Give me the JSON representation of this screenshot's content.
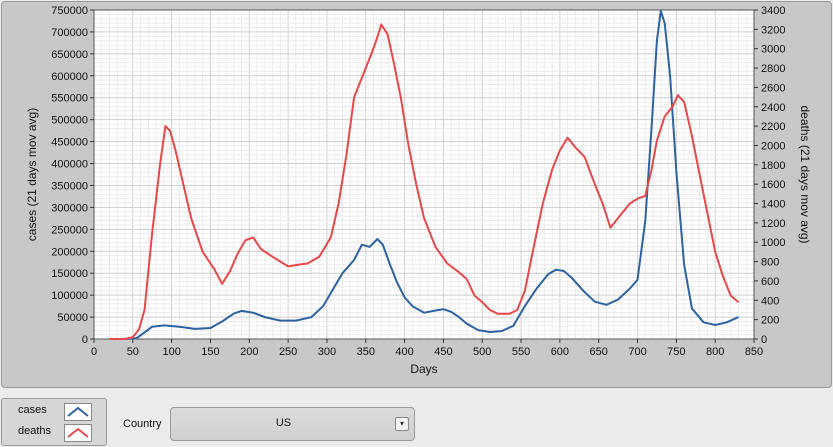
{
  "chart_data": {
    "type": "line",
    "xlabel": "Days",
    "ylabel_left": "cases  (21 days mov avg)",
    "ylabel_right": "deaths  (21 days mov avg)",
    "xlim": [
      0,
      850
    ],
    "ylim_left": [
      0,
      750000
    ],
    "ylim_right": [
      0,
      3400
    ],
    "x_ticks": [
      "0",
      "50",
      "100",
      "150",
      "200",
      "250",
      "300",
      "350",
      "400",
      "450",
      "500",
      "550",
      "600",
      "650",
      "700",
      "750",
      "800",
      "850"
    ],
    "y_left_ticks": [
      "0",
      "50000",
      "100000",
      "150000",
      "200000",
      "250000",
      "300000",
      "350000",
      "400000",
      "450000",
      "500000",
      "550000",
      "600000",
      "650000",
      "700000",
      "750000"
    ],
    "y_right_ticks": [
      "0",
      "200",
      "400",
      "600",
      "800",
      "1000",
      "1200",
      "1400",
      "1600",
      "1800",
      "2000",
      "2200",
      "2400",
      "2600",
      "2800",
      "3000",
      "3200",
      "3400"
    ],
    "grid": true,
    "series": [
      {
        "name": "cases",
        "axis": "left",
        "color": "#2e62a0",
        "points": [
          [
            20,
            0
          ],
          [
            40,
            0
          ],
          [
            55,
            2000
          ],
          [
            65,
            15000
          ],
          [
            75,
            28000
          ],
          [
            90,
            31000
          ],
          [
            110,
            28000
          ],
          [
            130,
            23000
          ],
          [
            150,
            25000
          ],
          [
            165,
            40000
          ],
          [
            180,
            58000
          ],
          [
            190,
            64000
          ],
          [
            205,
            60000
          ],
          [
            220,
            50000
          ],
          [
            240,
            42000
          ],
          [
            260,
            42000
          ],
          [
            280,
            50000
          ],
          [
            295,
            75000
          ],
          [
            310,
            120000
          ],
          [
            320,
            150000
          ],
          [
            335,
            180000
          ],
          [
            345,
            215000
          ],
          [
            355,
            210000
          ],
          [
            365,
            228000
          ],
          [
            372,
            215000
          ],
          [
            380,
            175000
          ],
          [
            390,
            130000
          ],
          [
            400,
            95000
          ],
          [
            410,
            75000
          ],
          [
            425,
            60000
          ],
          [
            440,
            65000
          ],
          [
            450,
            68000
          ],
          [
            460,
            62000
          ],
          [
            470,
            50000
          ],
          [
            480,
            35000
          ],
          [
            495,
            20000
          ],
          [
            510,
            16000
          ],
          [
            525,
            18000
          ],
          [
            540,
            30000
          ],
          [
            555,
            75000
          ],
          [
            570,
            115000
          ],
          [
            585,
            148000
          ],
          [
            595,
            158000
          ],
          [
            605,
            155000
          ],
          [
            615,
            140000
          ],
          [
            630,
            110000
          ],
          [
            645,
            85000
          ],
          [
            660,
            78000
          ],
          [
            675,
            90000
          ],
          [
            690,
            115000
          ],
          [
            700,
            135000
          ],
          [
            710,
            270000
          ],
          [
            718,
            480000
          ],
          [
            725,
            680000
          ],
          [
            730,
            748000
          ],
          [
            735,
            720000
          ],
          [
            742,
            600000
          ],
          [
            750,
            380000
          ],
          [
            760,
            170000
          ],
          [
            770,
            70000
          ],
          [
            785,
            38000
          ],
          [
            800,
            32000
          ],
          [
            815,
            38000
          ],
          [
            830,
            50000
          ]
        ]
      },
      {
        "name": "deaths",
        "axis": "right",
        "color": "#e8484c",
        "points": [
          [
            20,
            0
          ],
          [
            40,
            0
          ],
          [
            50,
            20
          ],
          [
            58,
            100
          ],
          [
            65,
            300
          ],
          [
            75,
            1100
          ],
          [
            85,
            1800
          ],
          [
            92,
            2200
          ],
          [
            98,
            2150
          ],
          [
            105,
            1950
          ],
          [
            115,
            1600
          ],
          [
            125,
            1250
          ],
          [
            140,
            900
          ],
          [
            155,
            720
          ],
          [
            165,
            570
          ],
          [
            175,
            700
          ],
          [
            185,
            880
          ],
          [
            195,
            1020
          ],
          [
            205,
            1050
          ],
          [
            215,
            930
          ],
          [
            230,
            850
          ],
          [
            250,
            750
          ],
          [
            265,
            770
          ],
          [
            275,
            780
          ],
          [
            290,
            850
          ],
          [
            305,
            1050
          ],
          [
            315,
            1400
          ],
          [
            325,
            1900
          ],
          [
            335,
            2500
          ],
          [
            345,
            2700
          ],
          [
            355,
            2900
          ],
          [
            362,
            3050
          ],
          [
            370,
            3250
          ],
          [
            378,
            3150
          ],
          [
            385,
            2900
          ],
          [
            395,
            2500
          ],
          [
            405,
            2000
          ],
          [
            415,
            1600
          ],
          [
            425,
            1250
          ],
          [
            440,
            950
          ],
          [
            455,
            780
          ],
          [
            470,
            690
          ],
          [
            480,
            620
          ],
          [
            490,
            450
          ],
          [
            500,
            380
          ],
          [
            510,
            300
          ],
          [
            520,
            260
          ],
          [
            535,
            260
          ],
          [
            545,
            300
          ],
          [
            555,
            500
          ],
          [
            565,
            900
          ],
          [
            578,
            1400
          ],
          [
            590,
            1750
          ],
          [
            600,
            1950
          ],
          [
            610,
            2080
          ],
          [
            620,
            1980
          ],
          [
            632,
            1880
          ],
          [
            645,
            1600
          ],
          [
            655,
            1400
          ],
          [
            665,
            1150
          ],
          [
            675,
            1250
          ],
          [
            690,
            1400
          ],
          [
            700,
            1450
          ],
          [
            710,
            1480
          ],
          [
            718,
            1750
          ],
          [
            725,
            2050
          ],
          [
            735,
            2300
          ],
          [
            745,
            2400
          ],
          [
            752,
            2520
          ],
          [
            760,
            2450
          ],
          [
            770,
            2100
          ],
          [
            780,
            1700
          ],
          [
            790,
            1300
          ],
          [
            800,
            900
          ],
          [
            810,
            650
          ],
          [
            820,
            450
          ],
          [
            830,
            380
          ]
        ]
      }
    ]
  },
  "legend": {
    "items": [
      {
        "label": "cases",
        "color": "#2e62a0"
      },
      {
        "label": "deaths",
        "color": "#e8484c"
      }
    ]
  },
  "controls": {
    "country_label": "Country",
    "country_value": "US",
    "arrow_glyph": "▾"
  }
}
